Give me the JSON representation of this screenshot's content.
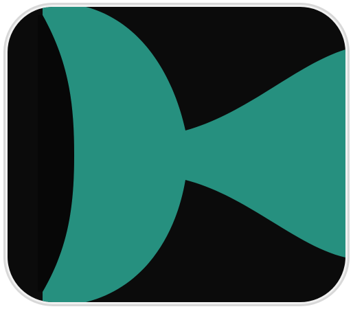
{
  "icon": {
    "name": "teal-fish-logo-icon",
    "background_color": "#0b0b0b",
    "bezel_color": "#d8d8d8",
    "mark_color": "#26907f"
  }
}
